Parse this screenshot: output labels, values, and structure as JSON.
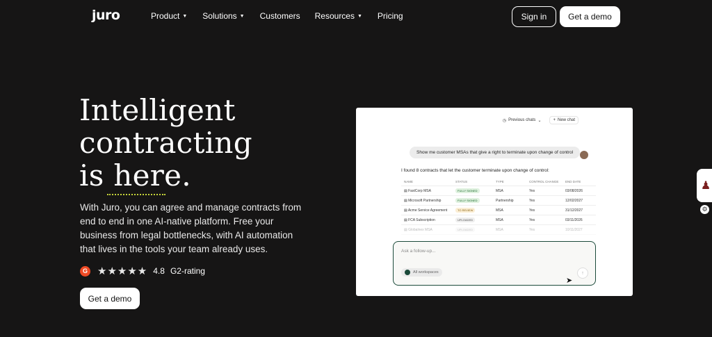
{
  "brand": {
    "logo": "juro"
  },
  "nav": {
    "items": [
      {
        "label": "Product",
        "dropdown": true
      },
      {
        "label": "Solutions",
        "dropdown": true
      },
      {
        "label": "Customers",
        "dropdown": false
      },
      {
        "label": "Resources",
        "dropdown": true
      },
      {
        "label": "Pricing",
        "dropdown": false
      }
    ],
    "sign_in": "Sign in",
    "get_demo": "Get a demo"
  },
  "hero": {
    "title_line1": "Intelligent",
    "title_line2": "contracting",
    "title_line3": "is here.",
    "subtitle": "With Juro, you can agree and manage contracts from end to end in one AI-native platform. Free your business from legal bottlenecks, with AI automation that lives in the tools your team already uses.",
    "rating_value": "4.8",
    "rating_label": "G2-rating",
    "stars": "★★★★★",
    "cta": "Get a demo"
  },
  "mock": {
    "previous_chats": "Previous chats",
    "new_chat": "New chat",
    "question": "Show me customer MSAs that give a right to terminate upon change of control",
    "answer": "I found 8 contracts that let the customer terminate upon change of control:",
    "columns": [
      "NAME",
      "STATUS",
      "TYPE",
      "CONTROL CHANGE",
      "END DATE"
    ],
    "rows": [
      {
        "name": "FastCorp MSA",
        "status": "FULLY SIGNED",
        "status_kind": "green",
        "type": "MSA",
        "change": "Yes",
        "end": "03/08/2026"
      },
      {
        "name": "Microsoft Partnership",
        "status": "FULLY SIGNED",
        "status_kind": "green",
        "type": "Partnership",
        "change": "Yes",
        "end": "12/02/2027"
      },
      {
        "name": "Acme Service Agreement",
        "status": "TO REVIEW",
        "status_kind": "amber",
        "type": "MSA",
        "change": "Yes",
        "end": "31/12/2027"
      },
      {
        "name": "FCA Subscription",
        "status": "UPLOADED",
        "status_kind": "grey",
        "type": "MSA",
        "change": "Yes",
        "end": "03/11/2026"
      },
      {
        "name": "Globalnex MSA",
        "status": "UPLOADED",
        "status_kind": "grey",
        "type": "MSA",
        "change": "Yes",
        "end": "10/11/2027"
      }
    ],
    "chat_placeholder": "Ask a follow-up...",
    "workspace": "All workspaces"
  }
}
